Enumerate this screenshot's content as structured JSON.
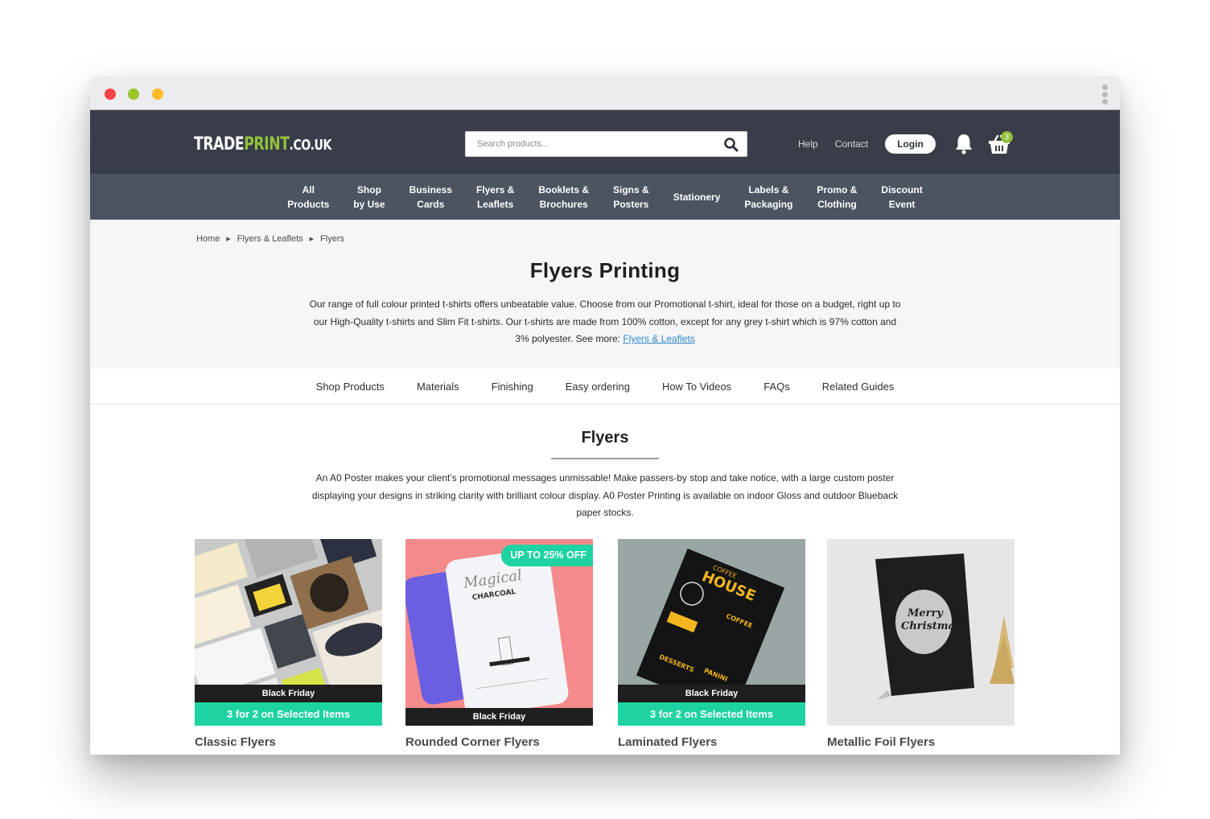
{
  "browser": {
    "controls": [
      "close",
      "minimize",
      "maximize"
    ],
    "menu_icon": "kebab-menu-icon"
  },
  "header": {
    "logo": {
      "trade": "TRADE",
      "print": "PRINT",
      "tld": ".CO.UK"
    },
    "search": {
      "placeholder": "Search products...",
      "value": "",
      "icon": "search-icon"
    },
    "links": {
      "help": "Help",
      "contact": "Contact"
    },
    "login_label": "Login",
    "bell_icon": "bell-icon",
    "cart": {
      "icon": "basket-icon",
      "count": "3"
    },
    "brand_green": "#94c23d"
  },
  "nav": {
    "items": [
      {
        "label": "All\nProducts"
      },
      {
        "label": "Shop\nby Use"
      },
      {
        "label": "Business\nCards"
      },
      {
        "label": "Flyers &\nLeaflets"
      },
      {
        "label": "Booklets &\nBrochures"
      },
      {
        "label": "Signs &\nPosters"
      },
      {
        "label": "Stationery"
      },
      {
        "label": "Labels &\nPackaging"
      },
      {
        "label": "Promo &\nClothing"
      },
      {
        "label": "Discount\nEvent"
      }
    ]
  },
  "breadcrumb": {
    "items": [
      "Home",
      "Flyers & Leaflets",
      "Flyers"
    ]
  },
  "hero": {
    "title": "Flyers Printing",
    "description": "Our range of full colour printed t-shirts offers unbeatable value. Choose from our Promotional t-shirt, ideal for those on a budget, right up to our High-Quality t-shirts and Slim Fit t-shirts. Our t-shirts are made from 100% cotton, except for any grey t-shirt which is 97% cotton and 3% polyester. See more: ",
    "link_label": "Flyers & Leaflets"
  },
  "tabs": {
    "items": [
      "Shop Products",
      "Materials",
      "Finishing",
      "Easy ordering",
      "How To Videos",
      "FAQs",
      "Related Guides"
    ]
  },
  "section": {
    "title": "Flyers",
    "description": "An A0 Poster makes your client’s promotional messages unmissable! Make passers-by stop and take notice, with a large custom poster displaying your designs in striking clarity with brilliant colour display. A0 Poster Printing is available on indoor Gloss and outdoor Blueback paper stocks."
  },
  "products": [
    {
      "name": "Classic Flyers",
      "badge": "Black Friday",
      "promo": "3 for 2 on Selected Items",
      "ribbon": ""
    },
    {
      "name": "Rounded Corner Flyers",
      "badge": "Black Friday",
      "promo": "",
      "ribbon": "UP TO 25% OFF"
    },
    {
      "name": "Laminated Flyers",
      "badge": "Black Friday",
      "promo": "3 for 2 on Selected Items",
      "ribbon": ""
    },
    {
      "name": "Metallic Foil Flyers",
      "badge": "",
      "promo": "",
      "ribbon": "",
      "image_text": "Merry Christmas"
    }
  ],
  "colors": {
    "header_bg": "#383d49",
    "nav_bg": "#4c5461",
    "promo_green": "#1ed3a1",
    "badge_black": "#1f1f1f",
    "link_blue": "#2d87c9"
  }
}
